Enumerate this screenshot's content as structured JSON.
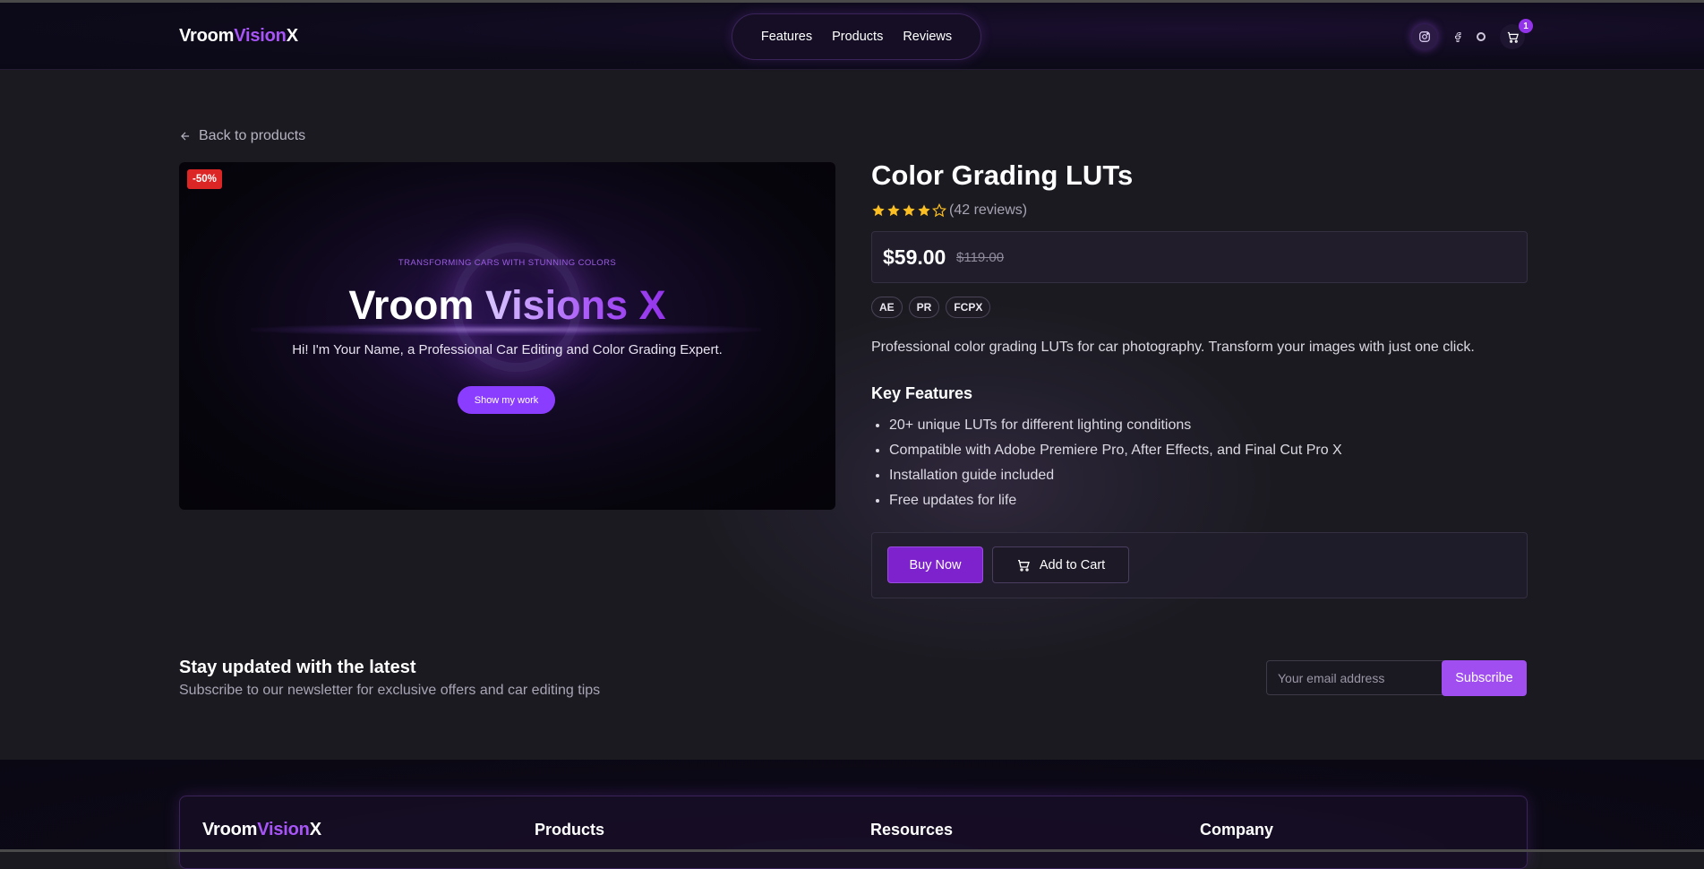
{
  "brand": {
    "part1": "Vroom",
    "part2": "Vision",
    "part3": "X"
  },
  "nav": {
    "links": [
      "Features",
      "Products",
      "Reviews"
    ],
    "cart_count": "1"
  },
  "back_link": "Back to products",
  "hero": {
    "discount": "-50%",
    "tagline": "TRANSFORMING CARS WITH STUNNING COLORS",
    "title_main": "Vroom ",
    "title_accent": "Visions X",
    "subtitle": "Hi! I'm Your Name, a Professional Car Editing and Color Grading Expert.",
    "button": "Show my work"
  },
  "product": {
    "title": "Color Grading LUTs",
    "rating": 4,
    "rating_max": 5,
    "reviews": "(42 reviews)",
    "price": "$59.00",
    "old_price": "$119.00",
    "tags": [
      "AE",
      "PR",
      "FCPX"
    ],
    "description": "Professional color grading LUTs for car photography. Transform your images with just one click.",
    "key_features_title": "Key Features",
    "features": [
      "20+ unique LUTs for different lighting conditions",
      "Compatible with Adobe Premiere Pro, After Effects, and Final Cut Pro X",
      "Installation guide included",
      "Free updates for life"
    ],
    "buy_label": "Buy Now",
    "cart_label": "Add to Cart"
  },
  "newsletter": {
    "title": "Stay updated with the latest",
    "subtitle": "Subscribe to our newsletter for exclusive offers and car editing tips",
    "placeholder": "Your email address",
    "button": "Subscribe"
  },
  "footer": {
    "columns": [
      "Products",
      "Resources",
      "Company"
    ]
  },
  "colors": {
    "accent": "#a855f7",
    "star": "#fbbf24",
    "discount": "#dc2626",
    "buy": "#7e22ce"
  },
  "icons": [
    "arrow-left-icon",
    "instagram-icon",
    "facebook-icon",
    "circle-icon",
    "cart-icon",
    "star-icon"
  ]
}
